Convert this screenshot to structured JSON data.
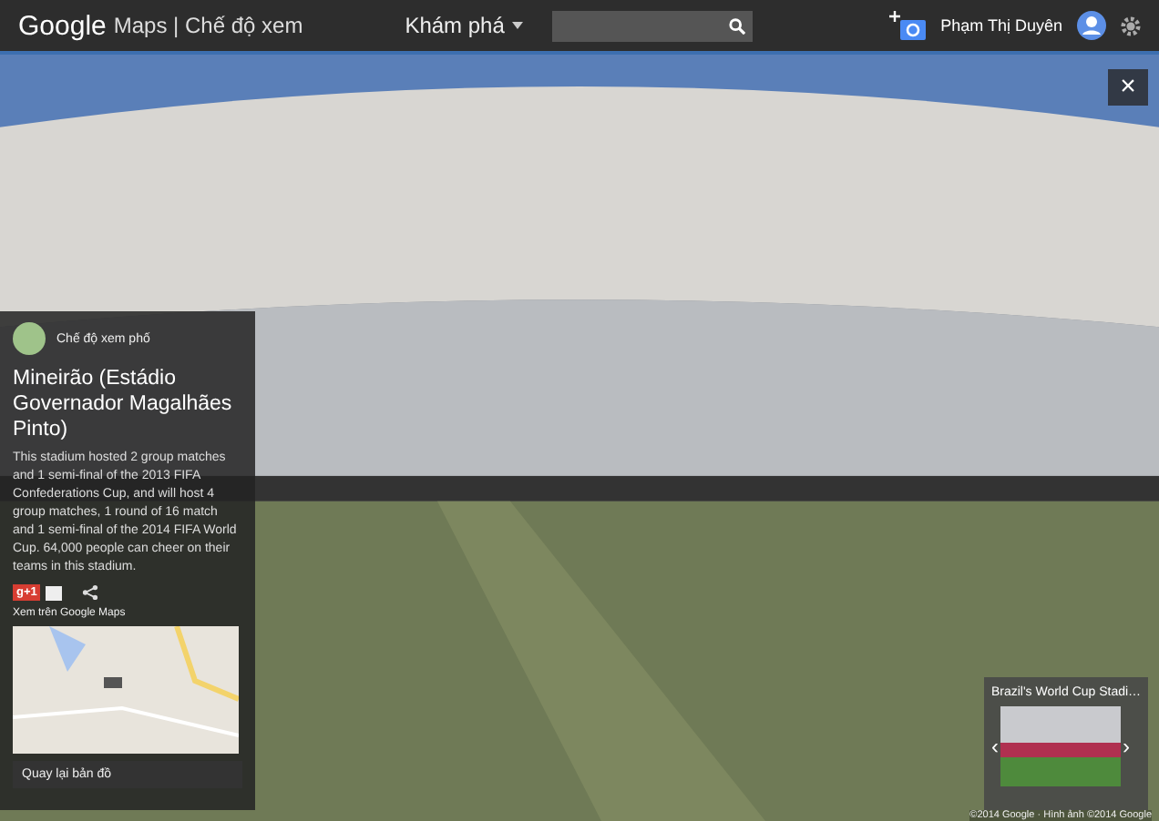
{
  "topbar": {
    "logo": "Google",
    "product": "Maps | Chế độ xem",
    "explore": "Khám phá",
    "user": "Phạm Thị Duyên"
  },
  "panel": {
    "mode": "Chế độ xem phố",
    "title": "Mineirão (Estádio Governador Magalhães Pinto)",
    "description": "This stadium hosted 2 group matches and 1 semi-final of the 2013 FIFA Confederations Cup, and will host 4 group matches, 1 round of 16 match and 1 semi-final of the 2014 FIFA World Cup. 64,000 people can cheer on their teams in this stadium.",
    "plus_one": "g+1",
    "maps_link": "Xem trên Google Maps",
    "back": "Quay lại bản đồ"
  },
  "thumbnail": {
    "title": "Brazil's World Cup Stadi…",
    "prev": "‹",
    "next": "›"
  },
  "close": "×",
  "copyright": "©2014 Google · Hình ảnh ©2014 Google"
}
